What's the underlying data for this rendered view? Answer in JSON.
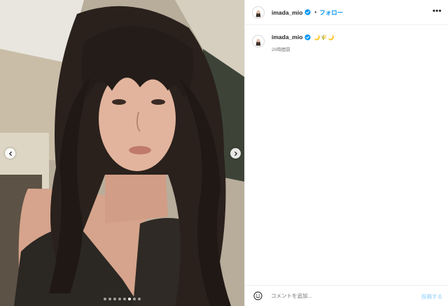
{
  "post": {
    "header": {
      "username": "imada_mio",
      "separator": "•",
      "follow_label": "フォロー",
      "more_label": "•••",
      "verified_icon": "verified-badge-icon"
    },
    "caption": {
      "username": "imada_mio",
      "emojis": "🌙🌾🌙",
      "time": "20時間前"
    },
    "media": {
      "prev_icon": "chevron-left-icon",
      "next_icon": "chevron-right-icon",
      "slide_count": 8,
      "active_slide": 6
    },
    "comment": {
      "emoji_icon": "smiley-icon",
      "placeholder": "コメントを追加...",
      "post_label": "投稿する"
    }
  },
  "colors": {
    "accent": "#0095f6",
    "post_disabled": "#b2dffc",
    "text": "#262626",
    "muted": "#737373",
    "border": "#efefef"
  }
}
